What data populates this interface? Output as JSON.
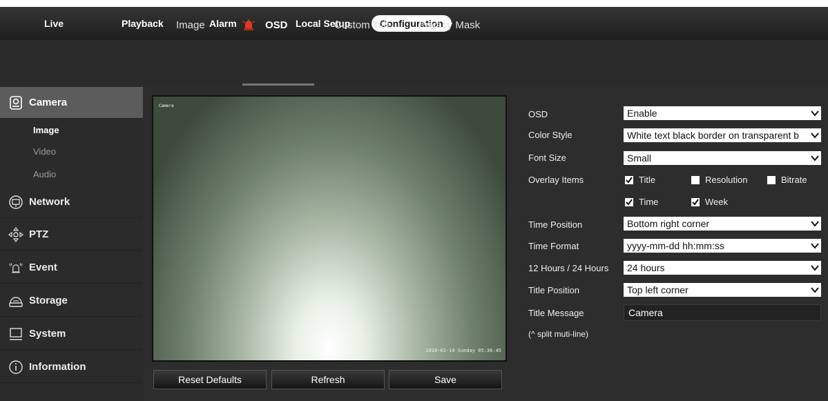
{
  "nav": {
    "live": "Live",
    "playback": "Playback",
    "alarm": "Alarm",
    "local_setup": "Local Setup",
    "configuration": "Configuration"
  },
  "tabs": [
    "Image",
    "OSD",
    "Custom Title",
    "Privacy Mask"
  ],
  "sidebar": {
    "camera": "Camera",
    "camera_sub": [
      "Image",
      "Video",
      "Audio"
    ],
    "network": "Network",
    "ptz": "PTZ",
    "event": "Event",
    "storage": "Storage",
    "system": "System",
    "information": "Information"
  },
  "preview": {
    "title_overlay": "Camera",
    "time_overlay": "2018-01-14 Sunday 05:36:45"
  },
  "buttons": {
    "reset": "Reset Defaults",
    "refresh": "Refresh",
    "save": "Save"
  },
  "form": {
    "osd_label": "OSD",
    "osd_value": "Enable",
    "color_style_label": "Color Style",
    "color_style_value": "White text black border on transparent b",
    "font_size_label": "Font Size",
    "font_size_value": "Small",
    "overlay_items_label": "Overlay Items",
    "overlay_title": "Title",
    "overlay_resolution": "Resolution",
    "overlay_bitrate": "Bitrate",
    "overlay_time": "Time",
    "overlay_week": "Week",
    "time_position_label": "Time Position",
    "time_position_value": "Bottom right corner",
    "time_format_label": "Time Format",
    "time_format_value": "yyyy-mm-dd hh:mm:ss",
    "hours_label": "12 Hours / 24 Hours",
    "hours_value": "24 hours",
    "title_position_label": "Title Position",
    "title_position_value": "Top left corner",
    "title_message_label": "Title Message",
    "title_message_value": "Camera",
    "split_hint": "(^ split muti-line)"
  },
  "checkbox_state": {
    "title": true,
    "resolution": false,
    "bitrate": false,
    "time": true,
    "week": true
  },
  "colors": {
    "alarm_icon": "#e03a1e",
    "active_side": "#5c5c5c"
  }
}
